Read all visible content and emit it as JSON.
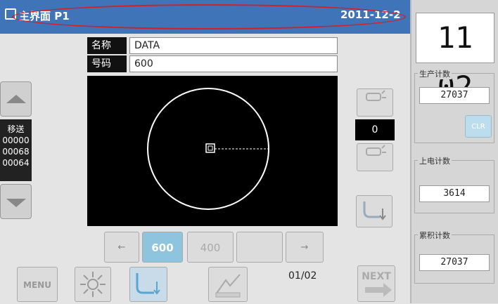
{
  "title_bar": {
    "screen_title": "主界面 P1",
    "date": "2011-12-2"
  },
  "pattern_info": {
    "name_label": "名称",
    "name_value": "DATA",
    "number_label": "号码",
    "number_value": "600"
  },
  "feed": {
    "label": "移送",
    "values": [
      "00000",
      "00068",
      "00064"
    ]
  },
  "speed": {
    "value": "0"
  },
  "pattern_list": {
    "prev_label": "←",
    "next_label": "→",
    "items": [
      "600",
      "400",
      ""
    ],
    "page_indicator": "01/02"
  },
  "toolbar": {
    "menu_label": "MENU",
    "next_label": "NEXT"
  },
  "clock": {
    "display": "11 02"
  },
  "counters": {
    "production_label": "生产计数",
    "production_value": "27037",
    "clear_label": "CLR",
    "power_on_label": "上电计数",
    "power_on_value": "3614",
    "cumulative_label": "累积计数",
    "cumulative_value": "27037"
  },
  "colors": {
    "title_bar": "#3f74b8",
    "selected_button": "#8ec4de",
    "highlight_outline": "#d0202a"
  }
}
